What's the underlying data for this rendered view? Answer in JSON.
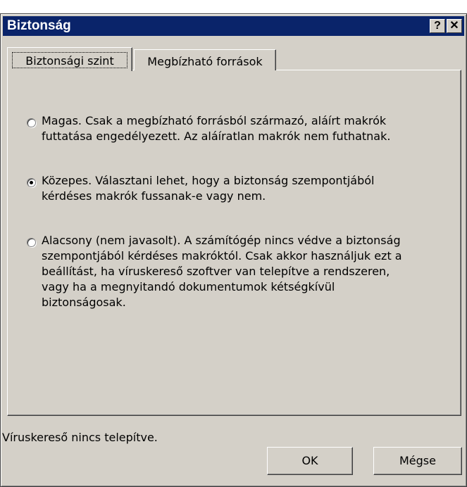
{
  "window": {
    "title": "Biztonság",
    "help_button": "?",
    "close_button": "✕"
  },
  "tabs": [
    {
      "label": "Biztonsági szint",
      "selected": true
    },
    {
      "label": "Megbízható források",
      "selected": false
    }
  ],
  "security_levels": [
    {
      "label": "Magas",
      "checked": false,
      "lines": [
        "Magas. Csak a megbízható forrásból származó, aláírt makrók",
        "futtatása engedélyezett. Az aláíratlan makrók nem futhatnak."
      ]
    },
    {
      "label": "Közepes",
      "checked": true,
      "lines": [
        "Közepes. Választani lehet, hogy a biztonság szempontjából",
        "kérdéses makrók fussanak-e vagy nem."
      ]
    },
    {
      "label": "Alacsony",
      "checked": false,
      "lines": [
        "Alacsony (nem javasolt). A számítógép nincs védve a biztonság",
        "szempontjából kérdéses makróktól. Csak akkor használjuk ezt a",
        "beállítást, ha víruskereső szoftver van telepítve a rendszeren,",
        "vagy ha a megnyitandó dokumentumok kétségkívül",
        "biztonságosak."
      ]
    }
  ],
  "status_text": "Víruskereső nincs telepítve.",
  "buttons": {
    "ok": "OK",
    "cancel": "Mégse"
  }
}
